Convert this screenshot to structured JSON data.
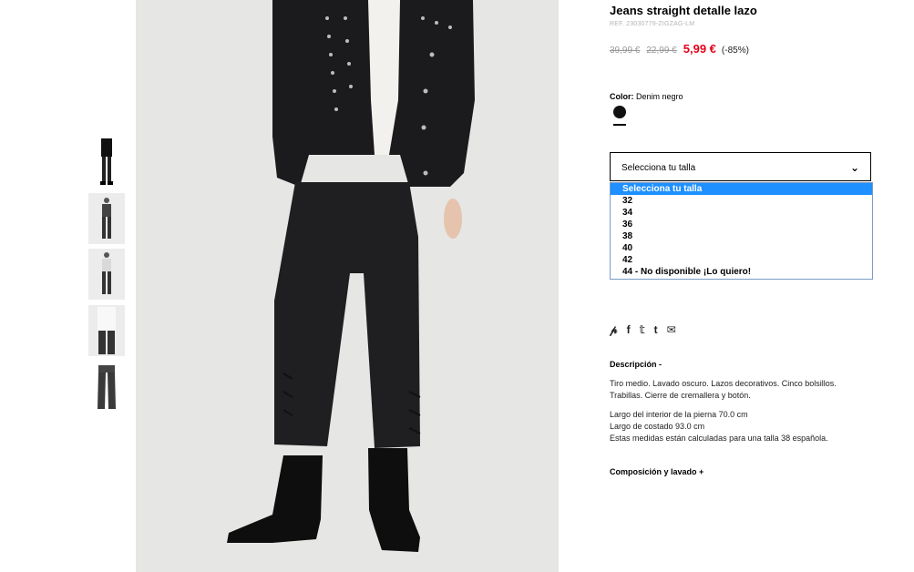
{
  "product": {
    "title": "Jeans straight detalle lazo",
    "ref": "REF. 23030779-ZIGZAG-LM",
    "price_original": "39,99 €",
    "price_previous": "22,99 €",
    "price_current": "5,99 €",
    "discount": "(-85%)"
  },
  "color": {
    "label": "Color:",
    "value": "Denim negro",
    "swatch_hex": "#111111"
  },
  "size_select": {
    "selected": "Selecciona tu talla",
    "options": [
      "Selecciona tu talla",
      "32",
      "34",
      "36",
      "38",
      "40",
      "42",
      "44 - No disponible ¡Lo quiero!"
    ],
    "highlight_color": "#1e90ff"
  },
  "social": [
    {
      "icon": "pinterest-icon",
      "glyph": "𝓅"
    },
    {
      "icon": "facebook-icon",
      "glyph": "f"
    },
    {
      "icon": "twitter-icon",
      "glyph": "🐦"
    },
    {
      "icon": "tumblr-icon",
      "glyph": "t"
    },
    {
      "icon": "email-icon",
      "glyph": "✉"
    }
  ],
  "description": {
    "heading": "Descripción -",
    "text": "Tiro medio. Lavado oscuro. Lazos decorativos. Cinco bolsillos. Trabillas. Cierre de cremallera y botón.",
    "measure_1": "Largo del interior de la pierna 70.0 cm",
    "measure_2": "Largo de costado 93.0 cm",
    "measure_3": "Estas medidas están calculadas para una talla 38 española."
  },
  "composition": {
    "heading": "Composición y lavado +"
  },
  "colors": {
    "sale_red": "#e2001a",
    "photo_bg": "#e6e6e4"
  }
}
